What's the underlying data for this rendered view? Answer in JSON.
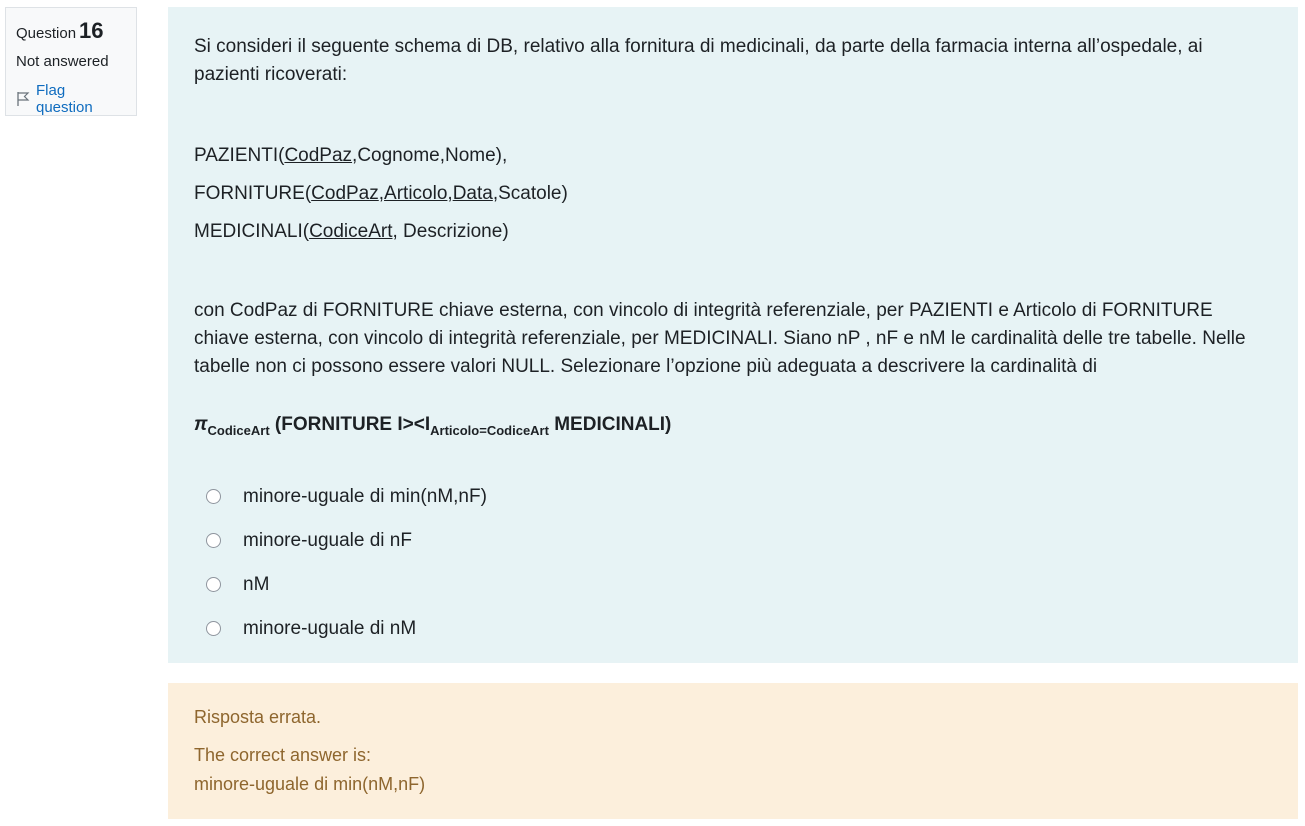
{
  "info": {
    "question_label": "Question",
    "question_number": "16",
    "state": "Not answered",
    "flag_label": "Flag question"
  },
  "question": {
    "intro": "Si consideri il seguente schema di DB, relativo alla fornitura di medicinali, da parte della farmacia interna all’ospedale, ai pazienti ricoverati:",
    "schema": {
      "pazienti": {
        "name": "PAZIENTI(",
        "key": "CodPaz",
        "rest": ",Cognome,Nome),"
      },
      "forniture": {
        "name": "FORNITURE(",
        "key1": "CodPaz",
        "sep1": ",",
        "key2": "Articolo",
        "sep2": ",",
        "key3": "Data",
        "rest": ",Scatole)"
      },
      "medicinali": {
        "name": "MEDICINALI(",
        "key": "CodiceArt",
        "rest": ", Descrizione)"
      }
    },
    "text": "con CodPaz di FORNITURE chiave esterna, con vincolo di integrità referenziale, per PAZIENTI e Articolo di FORNITURE chiave esterna, con vincolo di integrità referenziale, per MEDICINALI. Siano nP , nF e nM le cardinalità delle tre tabelle. Nelle tabelle non ci possono essere valori NULL. Selezionare l’opzione più adeguata a descrivere la cardinalità di",
    "expression": {
      "pi": "π",
      "pi_sub": "CodiceArt",
      "mid": " (FORNITURE I><I",
      "join_sub": "Articolo=CodiceArt",
      "end": " MEDICINALI)"
    },
    "options": [
      "minore-uguale di min(nM,nF)",
      "minore-uguale di nF",
      "nM",
      "minore-uguale di nM"
    ]
  },
  "feedback": {
    "result": "Risposta errata.",
    "correct_label": "The correct answer is:",
    "correct_answer": "minore-uguale di min(nM,nF)"
  }
}
